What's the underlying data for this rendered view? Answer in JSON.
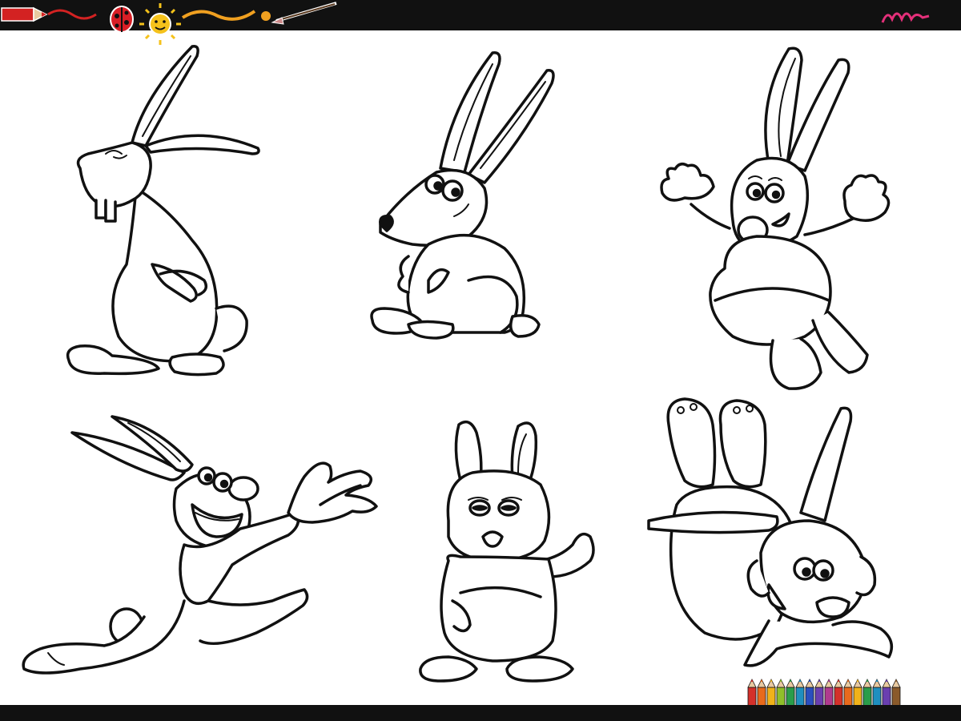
{
  "colors": {
    "bar": "#111111",
    "background": "#ffffff",
    "line": "#111111",
    "crayon_red": "#d32222",
    "ladybug": "#d81f26",
    "sun": "#f5c21b",
    "squiggle": "#f0a020",
    "scribble_pink": "#e4307a"
  },
  "pencil_colors": [
    "#d4302a",
    "#e86a1c",
    "#f0b21a",
    "#8fbf2a",
    "#2a9d4a",
    "#1f8fbf",
    "#2a4fbf",
    "#6a3fb0",
    "#b03a8f",
    "#d4302a",
    "#e86a1c",
    "#f0b21a",
    "#2a9d4a",
    "#1f8fbf",
    "#6a3fb0",
    "#8a5a2a"
  ],
  "icons": [
    "crayon-icon",
    "ladybug-icon",
    "sun-icon",
    "paintbrush-icon",
    "scribble-icon",
    "colored-pencils-icon"
  ],
  "bunnies": [
    "bunny-standing-buck-teeth",
    "bunny-sitting-profile",
    "bunny-jumping-arms-up",
    "bunny-running-grinning",
    "bunny-standing-waving",
    "bunny-upside-down-screaming"
  ]
}
